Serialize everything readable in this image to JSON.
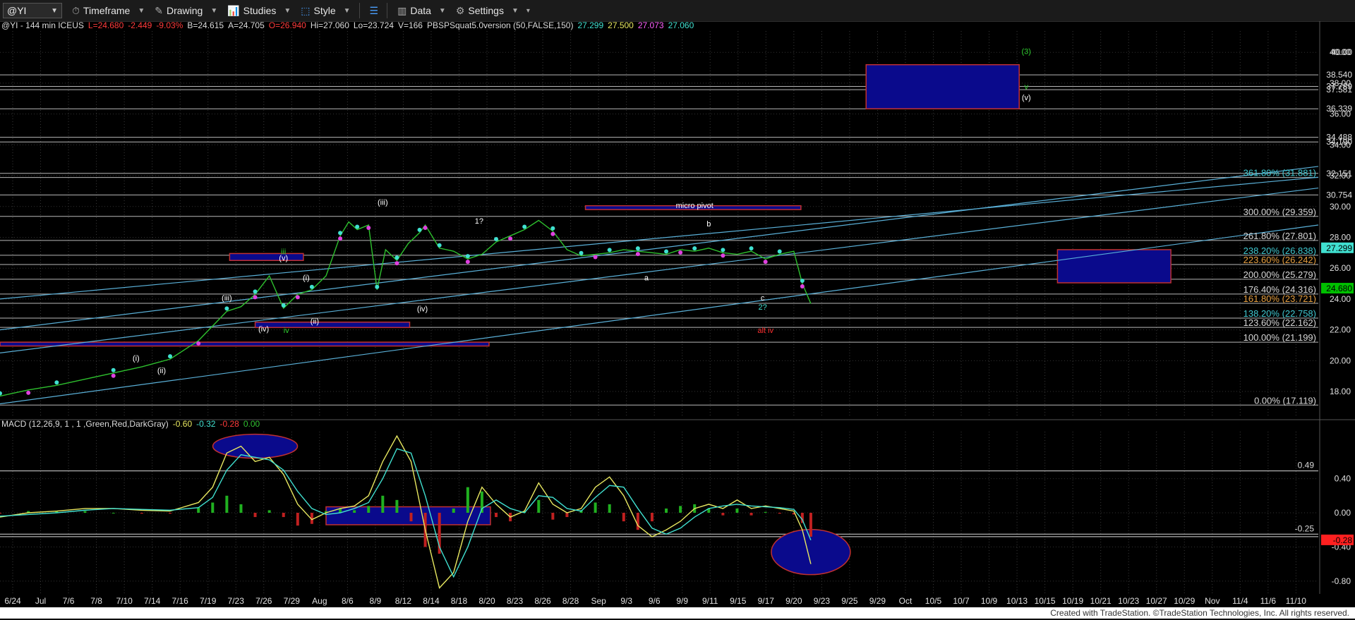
{
  "toolbar": {
    "symbol": "@YI",
    "timeframe": "Timeframe",
    "drawing": "Drawing",
    "studies": "Studies",
    "style": "Style",
    "data": "Data",
    "settings": "Settings"
  },
  "header": {
    "parts": [
      {
        "text": "@YI - 144 min  ICEUS",
        "color": "#dddddd"
      },
      {
        "text": "L=24.680",
        "color": "#ff3b3b"
      },
      {
        "text": "-2.449",
        "color": "#ff3b3b"
      },
      {
        "text": "-9.03%",
        "color": "#ff3b3b"
      },
      {
        "text": "B=24.615",
        "color": "#dddddd"
      },
      {
        "text": "A=24.705",
        "color": "#dddddd"
      },
      {
        "text": "O=26.940",
        "color": "#ff3b3b"
      },
      {
        "text": "Hi=27.060",
        "color": "#dddddd"
      },
      {
        "text": "Lo=23.724",
        "color": "#dddddd"
      },
      {
        "text": "V=166",
        "color": "#dddddd"
      },
      {
        "text": "PBSPSquat5.0version (50,FALSE,150)",
        "color": "#dddddd"
      },
      {
        "text": "27.299",
        "color": "#40e0d0"
      },
      {
        "text": "27.500",
        "color": "#e8e860"
      },
      {
        "text": "27.073",
        "color": "#ff60ff"
      },
      {
        "text": "27.060",
        "color": "#40e0d0"
      }
    ]
  },
  "macd_header": {
    "parts": [
      {
        "text": "MACD (12,26,9, 1 , 1 ,Green,Red,DarkGray)",
        "color": "#dddddd"
      },
      {
        "text": "-0.60",
        "color": "#e8e860"
      },
      {
        "text": "-0.32",
        "color": "#40e0d0"
      },
      {
        "text": "-0.28",
        "color": "#ff3b3b"
      },
      {
        "text": "0.00",
        "color": "#30c030"
      }
    ]
  },
  "footer": "Created with TradeStation. ©TradeStation Technologies, Inc. All rights reserved.",
  "chart_data": [
    {
      "type": "line",
      "title": "@YI - 144 min ICEUS",
      "ylim": [
        16.4,
        41.2
      ],
      "y_ticks": [
        18,
        20,
        22,
        24,
        26,
        28,
        30,
        32,
        34,
        36,
        38,
        40
      ],
      "x_ticks": [
        "6/24",
        "Jul",
        "7/6",
        "7/8",
        "7/10",
        "7/14",
        "7/16",
        "7/19",
        "7/23",
        "7/26",
        "7/29",
        "Aug",
        "8/6",
        "8/9",
        "8/12",
        "8/14",
        "8/18",
        "8/20",
        "8/23",
        "8/26",
        "8/28",
        "Sep",
        "9/3",
        "9/6",
        "9/9",
        "9/11",
        "9/15",
        "9/17",
        "9/20",
        "9/23",
        "9/25",
        "9/29",
        "Oct",
        "10/5",
        "10/7",
        "10/9",
        "10/13",
        "10/15",
        "10/19",
        "10/21",
        "10/23",
        "10/27",
        "10/29",
        "Nov",
        "11/4",
        "11/6",
        "11/10"
      ],
      "series": [
        {
          "name": "@YI",
          "x": [
            0,
            1,
            2,
            3,
            4,
            5,
            6,
            7,
            8,
            8.5,
            9,
            9.5,
            10,
            10.5,
            11,
            11.5,
            12,
            12.3,
            12.6,
            13,
            13.3,
            13.6,
            14,
            14.4,
            14.8,
            15,
            15.5,
            16,
            16.5,
            17,
            17.5,
            18,
            18.5,
            19,
            19.5,
            20,
            20.5,
            21,
            21.5,
            22,
            22.5,
            23,
            23.5,
            24,
            24.5,
            25,
            25.5,
            26,
            26.5,
            27,
            27.5,
            28,
            28.3,
            28.6
          ],
          "y": [
            17.7,
            18.1,
            18.4,
            18.8,
            19.2,
            19.6,
            20.1,
            21.3,
            23.2,
            23.5,
            24.3,
            25.5,
            23.4,
            24.3,
            24.6,
            25.5,
            28.1,
            29.0,
            28.5,
            28.8,
            24.6,
            27.2,
            26.5,
            27.6,
            28.3,
            28.8,
            27.3,
            27.1,
            26.6,
            26.9,
            27.7,
            28.1,
            28.5,
            29.1,
            28.4,
            27.2,
            26.8,
            26.9,
            27.0,
            27.2,
            27.1,
            27.0,
            26.9,
            27.2,
            27.1,
            27.3,
            27.0,
            26.9,
            27.1,
            26.6,
            26.9,
            27.1,
            25.0,
            23.7
          ]
        }
      ],
      "y_labels": [
        {
          "text": "40.00",
          "value": 40
        },
        {
          "text": "38.540",
          "value": 38.54
        },
        {
          "text": "37.789",
          "value": 37.79
        },
        {
          "text": "37.581",
          "value": 37.58
        },
        {
          "text": "36.339",
          "value": 36.34
        },
        {
          "text": "34.488",
          "value": 34.49
        },
        {
          "text": "34.190",
          "value": 34.19
        },
        {
          "text": "32.151",
          "value": 32.15
        },
        {
          "text": "30.754",
          "value": 30.75
        },
        {
          "text": "27.299",
          "value": 27.3,
          "bg": "#40e0d0"
        },
        {
          "text": "24.680",
          "value": 24.68,
          "bg": "#00c000"
        }
      ],
      "fib_labels": [
        {
          "text": "361.80% (31.881)",
          "value": 31.88,
          "color": "#40c8d0"
        },
        {
          "text": "300.00% (29.359)",
          "value": 29.36,
          "color": "#d8d8d8"
        },
        {
          "text": "261.80% (27.801)",
          "value": 27.8,
          "color": "#d8d8d8"
        },
        {
          "text": "238.20% (26.838)",
          "value": 26.84,
          "color": "#40c8d0"
        },
        {
          "text": "223.60% (26.242)",
          "value": 26.24,
          "color": "#e8a040"
        },
        {
          "text": "200.00% (25.279)",
          "value": 25.28,
          "color": "#d8d8d8"
        },
        {
          "text": "176.40% (24.316)",
          "value": 24.32,
          "color": "#d8d8d8"
        },
        {
          "text": "161.80% (23.721)",
          "value": 23.72,
          "color": "#e8a040"
        },
        {
          "text": "138.20% (22.758)",
          "value": 22.76,
          "color": "#40c8d0"
        },
        {
          "text": "123.60% (22.162)",
          "value": 22.16,
          "color": "#d8d8d8"
        },
        {
          "text": "100.00% (21.199)",
          "value": 21.2,
          "color": "#d8d8d8"
        },
        {
          "text": "0.00% (17.119)",
          "value": 17.12,
          "color": "#d8d8d8"
        }
      ],
      "wave_labels": [
        {
          "text": "(3)",
          "x": 36.2,
          "y": 39.9,
          "color": "#30d030"
        },
        {
          "text": "v",
          "x": 36.2,
          "y": 37.6,
          "color": "#30d030"
        },
        {
          "text": "(v)",
          "x": 36.2,
          "y": 36.9,
          "color": "#ffffff"
        },
        {
          "text": "(iii)",
          "x": 13.5,
          "y": 30.1,
          "color": "#ffffff"
        },
        {
          "text": "1?",
          "x": 16.9,
          "y": 28.9,
          "color": "#ffffff"
        },
        {
          "text": "micro pivot",
          "x": 24.5,
          "y": 29.9,
          "color": "#ffffff"
        },
        {
          "text": "b",
          "x": 25.0,
          "y": 28.7,
          "color": "#ffffff"
        },
        {
          "text": "iii",
          "x": 10.0,
          "y": 26.9,
          "color": "#30d030"
        },
        {
          "text": "(v)",
          "x": 10.0,
          "y": 26.5,
          "color": "#ffffff"
        },
        {
          "text": "(i)",
          "x": 10.8,
          "y": 25.2,
          "color": "#ffffff"
        },
        {
          "text": "a",
          "x": 22.8,
          "y": 25.2,
          "color": "#ffffff"
        },
        {
          "text": "(iii)",
          "x": 8.0,
          "y": 23.9,
          "color": "#ffffff"
        },
        {
          "text": "(ii)",
          "x": 11.1,
          "y": 22.4,
          "color": "#ffffff"
        },
        {
          "text": "(iv)",
          "x": 14.9,
          "y": 23.2,
          "color": "#ffffff"
        },
        {
          "text": "c",
          "x": 26.9,
          "y": 23.9,
          "color": "#ffffff"
        },
        {
          "text": "2?",
          "x": 26.9,
          "y": 23.3,
          "color": "#40e0d0"
        },
        {
          "text": "(iv)",
          "x": 9.3,
          "y": 21.9,
          "color": "#ffffff"
        },
        {
          "text": "iv",
          "x": 10.1,
          "y": 21.8,
          "color": "#30d030"
        },
        {
          "text": "alt iv",
          "x": 27.0,
          "y": 21.8,
          "color": "#ff3030"
        },
        {
          "text": "(i)",
          "x": 4.8,
          "y": 20.0,
          "color": "#ffffff"
        },
        {
          "text": "(ii)",
          "x": 5.7,
          "y": 19.2,
          "color": "#ffffff"
        }
      ],
      "grid": true
    },
    {
      "type": "line",
      "title": "MACD (12,26,9, 1 , 1 ,Green,Red,DarkGray)",
      "ylim": [
        -0.95,
        0.95
      ],
      "y_ticks": [
        0.4,
        0.0,
        -0.4,
        -0.8
      ],
      "y_tick_labels": [
        "0.40",
        "0.00",
        "-0.40",
        "-0.80"
      ],
      "extra_labels": [
        {
          "text": "0.49",
          "value": 0.49,
          "color": "#d8d8d8"
        },
        {
          "text": "-0.25",
          "value": -0.25,
          "color": "#d8d8d8"
        },
        {
          "text": "-0.28",
          "value": -0.28,
          "bg": "#ff2020"
        }
      ],
      "x": [
        0,
        1,
        2,
        3,
        4,
        5,
        6,
        7,
        7.5,
        8,
        8.5,
        9,
        9.5,
        10,
        10.5,
        11,
        11.5,
        12,
        12.5,
        13,
        13.5,
        14,
        14.5,
        15,
        15.5,
        16,
        16.5,
        17,
        17.5,
        18,
        18.5,
        19,
        19.5,
        20,
        20.5,
        21,
        21.5,
        22,
        22.5,
        23,
        23.5,
        24,
        24.5,
        25,
        25.5,
        26,
        26.5,
        27,
        27.5,
        28,
        28.3,
        28.6
      ],
      "series": [
        {
          "name": "MACD",
          "color": "#e8e860",
          "values": [
            -0.05,
            0.0,
            0.02,
            0.05,
            0.05,
            0.03,
            0.02,
            0.12,
            0.3,
            0.7,
            0.78,
            0.6,
            0.65,
            0.45,
            0.1,
            -0.08,
            0.0,
            0.05,
            0.08,
            0.2,
            0.6,
            0.9,
            0.6,
            -0.2,
            -0.88,
            -0.7,
            -0.1,
            0.3,
            0.1,
            -0.05,
            0.02,
            0.35,
            0.1,
            0.0,
            0.05,
            0.3,
            0.42,
            0.2,
            -0.15,
            -0.28,
            -0.2,
            -0.1,
            0.05,
            0.1,
            0.05,
            0.15,
            0.05,
            0.08,
            0.05,
            0.02,
            -0.2,
            -0.6
          ]
        },
        {
          "name": "Signal",
          "color": "#40e0d0",
          "values": [
            -0.04,
            -0.02,
            0.0,
            0.03,
            0.05,
            0.04,
            0.03,
            0.06,
            0.18,
            0.5,
            0.68,
            0.65,
            0.62,
            0.5,
            0.25,
            0.05,
            -0.02,
            0.0,
            0.05,
            0.12,
            0.4,
            0.75,
            0.7,
            0.2,
            -0.4,
            -0.75,
            -0.4,
            0.05,
            0.15,
            0.05,
            0.0,
            0.2,
            0.18,
            0.05,
            0.02,
            0.18,
            0.32,
            0.3,
            0.05,
            -0.18,
            -0.25,
            -0.18,
            -0.05,
            0.05,
            0.08,
            0.1,
            0.08,
            0.07,
            0.06,
            0.04,
            -0.08,
            -0.32
          ]
        }
      ]
    }
  ]
}
